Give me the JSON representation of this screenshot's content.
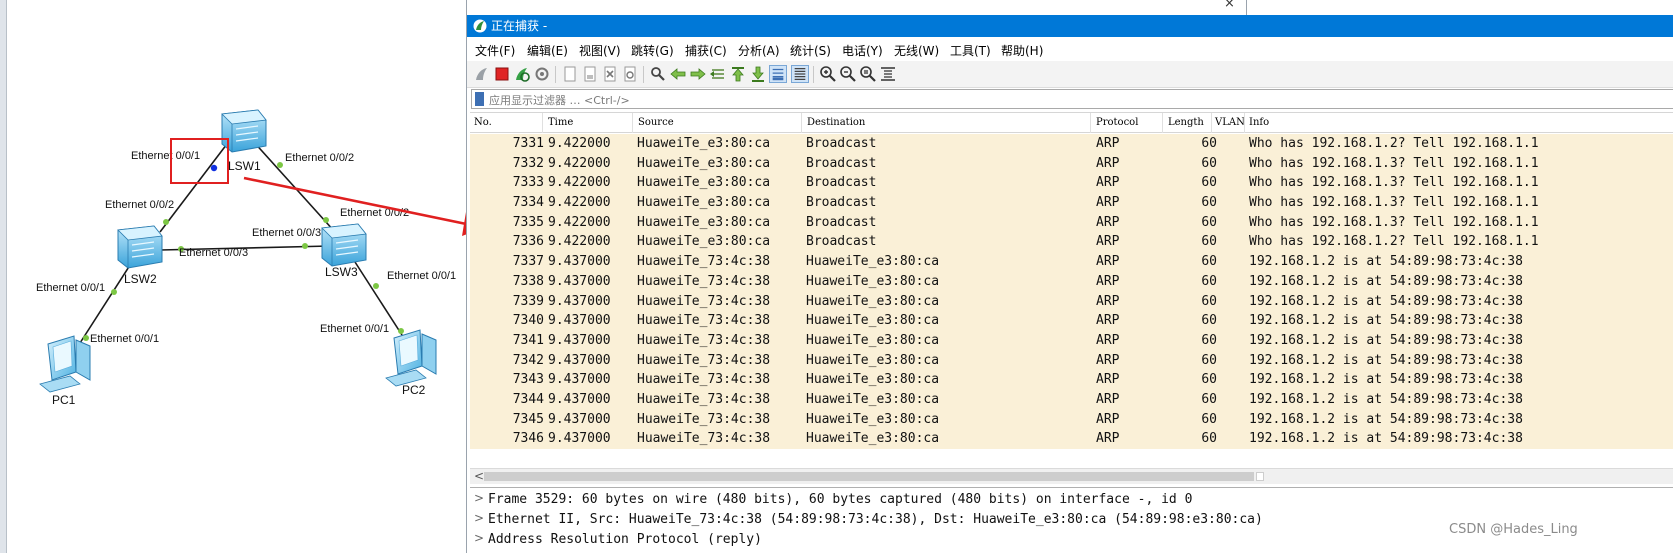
{
  "topology": {
    "devices": [
      {
        "id": "lsw1",
        "label": "LSW1"
      },
      {
        "id": "lsw2",
        "label": "LSW2"
      },
      {
        "id": "lsw3",
        "label": "LSW3"
      },
      {
        "id": "pc1",
        "label": "PC1"
      },
      {
        "id": "pc2",
        "label": "PC2"
      }
    ],
    "port_labels": {
      "lsw1_p1": "Ethernet 0/0/1",
      "lsw1_p2": "Ethernet 0/0/2",
      "lsw2_p2": "Ethernet 0/0/2",
      "lsw2_p3": "Ethernet 0/0/3",
      "lsw2_p1": "Ethernet 0/0/1",
      "lsw3_p3": "Ethernet 0/0/3",
      "lsw3_p2": "Ethernet 0/0/2",
      "lsw3_p1": "Ethernet 0/0/1",
      "pc1_p1": "Ethernet 0/0/1",
      "pc2_p1": "Ethernet 0/0/1"
    },
    "highlight_color": "#e02020",
    "link_color": "#1a1a1a",
    "port_dot_color": "#7cc744",
    "capture_dot_color": "#1030e0"
  },
  "window": {
    "title": "正在捕获 -",
    "close_glyph": "×"
  },
  "menu": [
    "文件(F)",
    "编辑(E)",
    "视图(V)",
    "跳转(G)",
    "捕获(C)",
    "分析(A)",
    "统计(S)",
    "电话(Y)",
    "无线(W)",
    "工具(T)",
    "帮助(H)"
  ],
  "toolbar": {
    "icons": [
      "shark-fin-start-icon",
      "stop-square-icon",
      "restart-capture-icon",
      "capture-options-gear-icon",
      "open-file-icon",
      "save-file-icon",
      "close-file-icon",
      "reload-file-icon",
      "find-packet-icon",
      "go-back-icon",
      "go-forward-icon",
      "go-to-packet-icon",
      "go-first-icon",
      "go-last-icon",
      "autoscroll-icon",
      "colorize-icon",
      "zoom-in-icon",
      "zoom-out-icon",
      "zoom-normal-icon",
      "resize-columns-icon"
    ]
  },
  "filter": {
    "placeholder": "应用显示过滤器 … <Ctrl-/>"
  },
  "columns": {
    "no": "No.",
    "time": "Time",
    "source": "Source",
    "destination": "Destination",
    "protocol": "Protocol",
    "length": "Length",
    "vlan": "VLAN",
    "info": "Info"
  },
  "packets": [
    {
      "no": "7331",
      "time": "9.422000",
      "source": "HuaweiTe_e3:80:ca",
      "destination": "Broadcast",
      "protocol": "ARP",
      "length": "60",
      "info": "Who has 192.168.1.2? Tell 192.168.1.1"
    },
    {
      "no": "7332",
      "time": "9.422000",
      "source": "HuaweiTe_e3:80:ca",
      "destination": "Broadcast",
      "protocol": "ARP",
      "length": "60",
      "info": "Who has 192.168.1.3? Tell 192.168.1.1"
    },
    {
      "no": "7333",
      "time": "9.422000",
      "source": "HuaweiTe_e3:80:ca",
      "destination": "Broadcast",
      "protocol": "ARP",
      "length": "60",
      "info": "Who has 192.168.1.3? Tell 192.168.1.1"
    },
    {
      "no": "7334",
      "time": "9.422000",
      "source": "HuaweiTe_e3:80:ca",
      "destination": "Broadcast",
      "protocol": "ARP",
      "length": "60",
      "info": "Who has 192.168.1.3? Tell 192.168.1.1"
    },
    {
      "no": "7335",
      "time": "9.422000",
      "source": "HuaweiTe_e3:80:ca",
      "destination": "Broadcast",
      "protocol": "ARP",
      "length": "60",
      "info": "Who has 192.168.1.3? Tell 192.168.1.1"
    },
    {
      "no": "7336",
      "time": "9.422000",
      "source": "HuaweiTe_e3:80:ca",
      "destination": "Broadcast",
      "protocol": "ARP",
      "length": "60",
      "info": "Who has 192.168.1.2? Tell 192.168.1.1"
    },
    {
      "no": "7337",
      "time": "9.437000",
      "source": "HuaweiTe_73:4c:38",
      "destination": "HuaweiTe_e3:80:ca",
      "protocol": "ARP",
      "length": "60",
      "info": "192.168.1.2 is at 54:89:98:73:4c:38"
    },
    {
      "no": "7338",
      "time": "9.437000",
      "source": "HuaweiTe_73:4c:38",
      "destination": "HuaweiTe_e3:80:ca",
      "protocol": "ARP",
      "length": "60",
      "info": "192.168.1.2 is at 54:89:98:73:4c:38"
    },
    {
      "no": "7339",
      "time": "9.437000",
      "source": "HuaweiTe_73:4c:38",
      "destination": "HuaweiTe_e3:80:ca",
      "protocol": "ARP",
      "length": "60",
      "info": "192.168.1.2 is at 54:89:98:73:4c:38"
    },
    {
      "no": "7340",
      "time": "9.437000",
      "source": "HuaweiTe_73:4c:38",
      "destination": "HuaweiTe_e3:80:ca",
      "protocol": "ARP",
      "length": "60",
      "info": "192.168.1.2 is at 54:89:98:73:4c:38"
    },
    {
      "no": "7341",
      "time": "9.437000",
      "source": "HuaweiTe_73:4c:38",
      "destination": "HuaweiTe_e3:80:ca",
      "protocol": "ARP",
      "length": "60",
      "info": "192.168.1.2 is at 54:89:98:73:4c:38"
    },
    {
      "no": "7342",
      "time": "9.437000",
      "source": "HuaweiTe_73:4c:38",
      "destination": "HuaweiTe_e3:80:ca",
      "protocol": "ARP",
      "length": "60",
      "info": "192.168.1.2 is at 54:89:98:73:4c:38"
    },
    {
      "no": "7343",
      "time": "9.437000",
      "source": "HuaweiTe_73:4c:38",
      "destination": "HuaweiTe_e3:80:ca",
      "protocol": "ARP",
      "length": "60",
      "info": "192.168.1.2 is at 54:89:98:73:4c:38"
    },
    {
      "no": "7344",
      "time": "9.437000",
      "source": "HuaweiTe_73:4c:38",
      "destination": "HuaweiTe_e3:80:ca",
      "protocol": "ARP",
      "length": "60",
      "info": "192.168.1.2 is at 54:89:98:73:4c:38"
    },
    {
      "no": "7345",
      "time": "9.437000",
      "source": "HuaweiTe_73:4c:38",
      "destination": "HuaweiTe_e3:80:ca",
      "protocol": "ARP",
      "length": "60",
      "info": "192.168.1.2 is at 54:89:98:73:4c:38"
    },
    {
      "no": "7346",
      "time": "9.437000",
      "source": "HuaweiTe_73:4c:38",
      "destination": "HuaweiTe_e3:80:ca",
      "protocol": "ARP",
      "length": "60",
      "info": "192.168.1.2 is at 54:89:98:73:4c:38"
    }
  ],
  "row_color": "#faf0d7",
  "details": [
    "Frame 3529: 60 bytes on wire (480 bits), 60 bytes captured (480 bits) on interface -, id 0",
    "Ethernet II, Src: HuaweiTe_73:4c:38 (54:89:98:73:4c:38), Dst: HuaweiTe_e3:80:ca (54:89:98:e3:80:ca)",
    "Address Resolution Protocol (reply)"
  ],
  "watermark": "CSDN @Hades_Ling"
}
